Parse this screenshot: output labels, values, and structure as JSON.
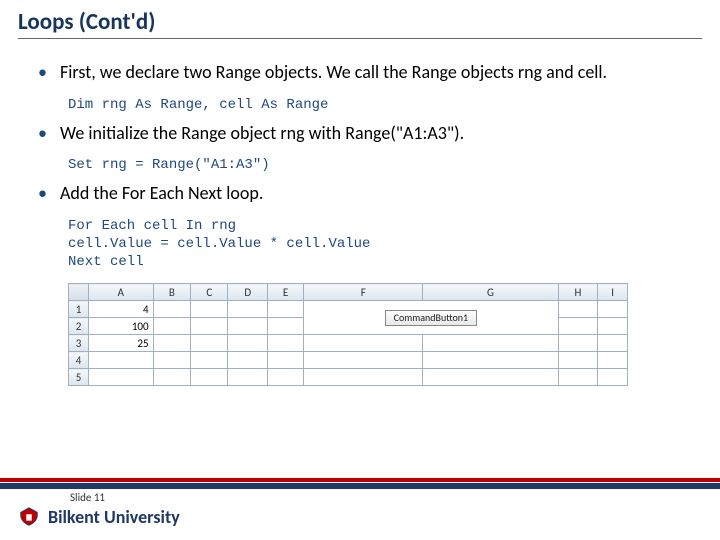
{
  "title": "Loops (Cont'd)",
  "bullets": {
    "b1": "First, we declare two Range objects. We call the Range objects rng and cell.",
    "b2": "We initialize the Range object rng with Range(\"A1:A3\").",
    "b3": "Add the For Each Next loop."
  },
  "code": {
    "c1": "Dim rng As Range, cell As Range",
    "c2": "Set rng = Range(\"A1:A3\")",
    "c3": "For Each cell In rng\ncell.Value = cell.Value * cell.Value\nNext cell"
  },
  "excel": {
    "cols": [
      "A",
      "B",
      "C",
      "D",
      "E",
      "F",
      "G",
      "H",
      "I"
    ],
    "rows": [
      "1",
      "2",
      "3",
      "4",
      "5"
    ],
    "a1": "4",
    "a2": "100",
    "a3": "25",
    "button_label": "CommandButton1"
  },
  "footer": {
    "slide": "Slide 11",
    "brand": "Bilkent University"
  }
}
